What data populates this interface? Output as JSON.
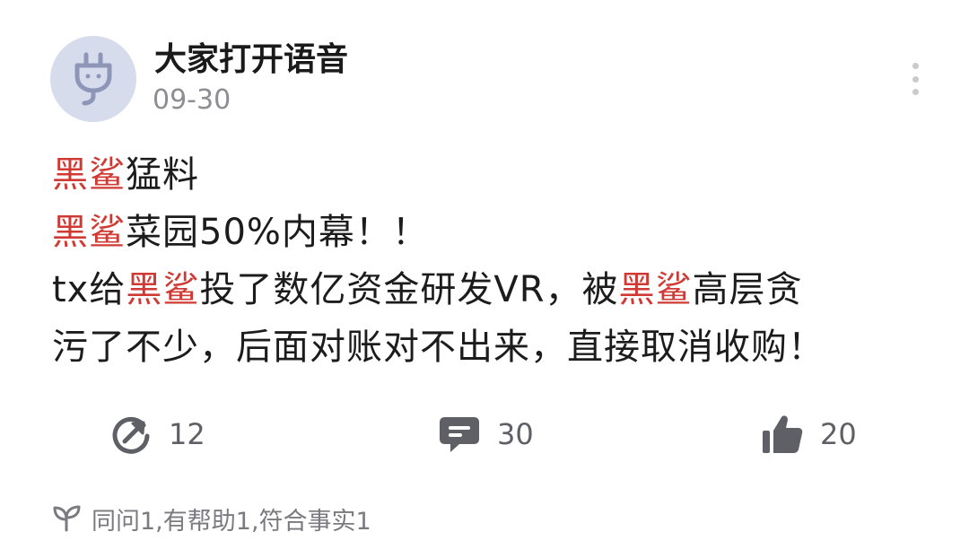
{
  "post": {
    "username": "大家打开语音",
    "date": "09-30",
    "avatar_icon": "plug-character-icon",
    "body": {
      "lines": [
        [
          {
            "text": "黑鲨",
            "highlight": true
          },
          {
            "text": "猛料",
            "highlight": false
          }
        ],
        [
          {
            "text": "黑鲨",
            "highlight": true
          },
          {
            "text": "菜园50%内幕！！",
            "highlight": false
          }
        ],
        [
          {
            "text": "tx给",
            "highlight": false
          },
          {
            "text": "黑鲨",
            "highlight": true
          },
          {
            "text": "投了数亿资金研发VR，被",
            "highlight": false
          },
          {
            "text": "黑鲨",
            "highlight": true
          },
          {
            "text": "高层贪",
            "highlight": false
          }
        ],
        [
          {
            "text": "污了不少，后面对账对不出来，直接取消收购！",
            "highlight": false
          }
        ]
      ]
    },
    "actions": {
      "share_count": "12",
      "comment_count": "30",
      "like_count": "20"
    },
    "reactions": {
      "text": "同问1,有帮助1,符合事实1",
      "icon": "sprout-icon"
    }
  },
  "colors": {
    "highlight": "#d03a35",
    "text": "#1c1c1c",
    "muted": "#8d8d93",
    "icon": "#5f5f66",
    "avatar_bg": "#d7dcec"
  }
}
